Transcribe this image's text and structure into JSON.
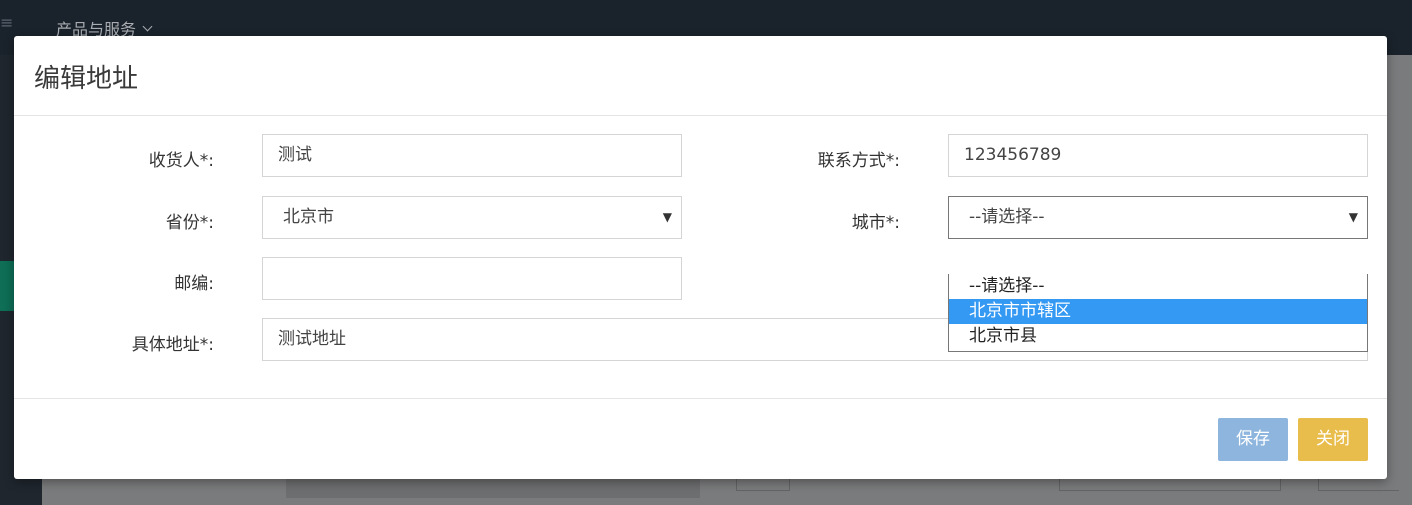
{
  "background": {
    "top_menu_label": "产品与服务",
    "colors": {
      "topbar": "#1a222b",
      "overlay": "#7f8081"
    }
  },
  "modal": {
    "title": "编辑地址",
    "fields": {
      "receiver": {
        "label": "收货人*:",
        "value": "测试"
      },
      "contact": {
        "label": "联系方式*:",
        "value": "123456789"
      },
      "province": {
        "label": "省份*:",
        "value": "北京市"
      },
      "city": {
        "label": "城市*:",
        "value": "--请选择--"
      },
      "postcode": {
        "label": "邮编:",
        "value": ""
      },
      "address": {
        "label": "具体地址*:",
        "value": "测试地址"
      }
    },
    "city_dropdown": {
      "options": [
        "--请选择--",
        "北京市市辖区",
        "北京市县"
      ],
      "highlighted_index": 1
    },
    "buttons": {
      "save": "保存",
      "close": "关闭"
    },
    "colors": {
      "save": "#8db5dd",
      "close": "#e8bd4c",
      "highlight": "#3399f3"
    }
  }
}
